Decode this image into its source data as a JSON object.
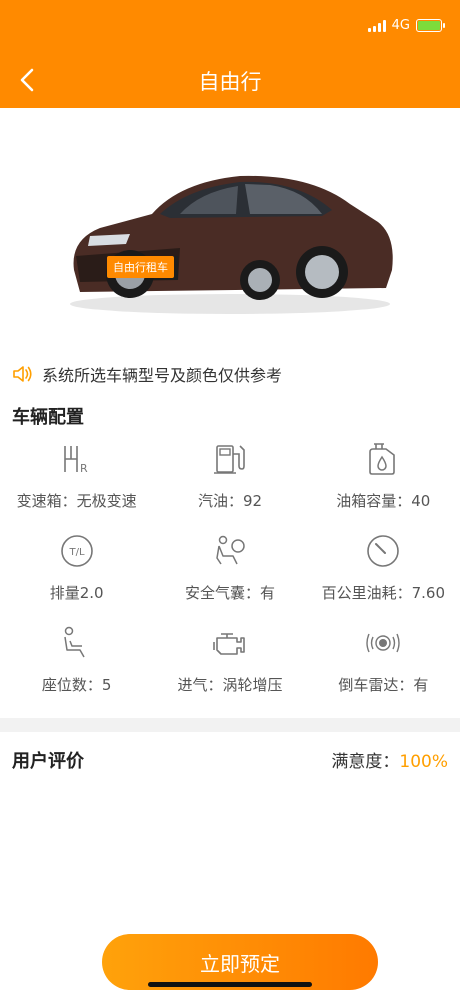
{
  "status": {
    "network": "4G"
  },
  "header": {
    "title": "自由行"
  },
  "car": {
    "tag": "自由行租车"
  },
  "notice": {
    "text": "系统所选车辆型号及颜色仅供参考"
  },
  "config": {
    "title": "车辆配置",
    "items": [
      {
        "icon": "gearbox-icon",
        "label": "变速箱：无极变速"
      },
      {
        "icon": "fuel-pump-icon",
        "label": "汽油：92"
      },
      {
        "icon": "oil-tank-icon",
        "label": "油箱容量：40"
      },
      {
        "icon": "transmission-badge-icon",
        "badge": "T/L",
        "label": "排量2.0"
      },
      {
        "icon": "airbag-icon",
        "label": "安全气囊：有"
      },
      {
        "icon": "gauge-icon",
        "label": "百公里油耗：7.60"
      },
      {
        "icon": "seat-icon",
        "label": "座位数：5"
      },
      {
        "icon": "engine-icon",
        "label": "进气：涡轮增压"
      },
      {
        "icon": "radar-icon",
        "label": "倒车雷达：有"
      }
    ]
  },
  "evaluation": {
    "title": "用户评价",
    "satisfaction_label": "满意度：",
    "satisfaction_value": "100%"
  },
  "book_button": {
    "label": "立即预定"
  },
  "colors": {
    "accent": "#ff8a00",
    "satisfaction": "#ff9f00"
  }
}
